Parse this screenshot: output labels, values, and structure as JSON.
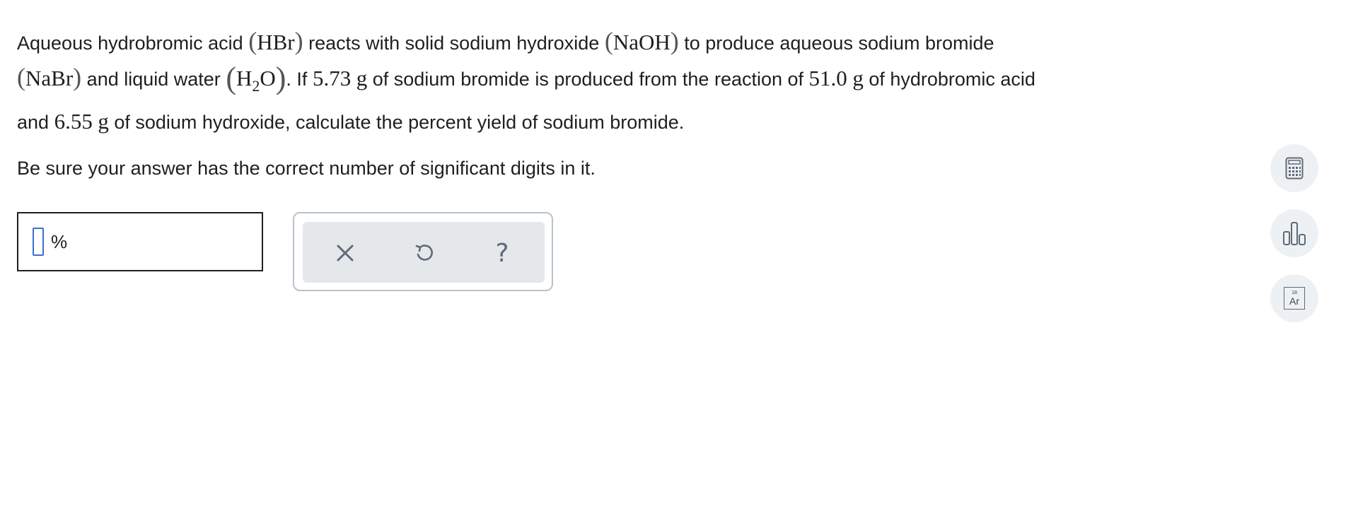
{
  "question": {
    "t1": "Aqueous hydrobromic acid",
    "hbr_formula": "HBr",
    "t2": "reacts with solid sodium hydroxide",
    "naoh_formula": "NaOH",
    "t3": "to produce aqueous sodium bromide",
    "nabr_formula": "NaBr",
    "t4": "and liquid water",
    "water_h": "H",
    "water_sub": "2",
    "water_o": "O",
    "t5": ". If",
    "nabr_mass": "5.73",
    "unit_g1": "g",
    "t6": "of sodium bromide is produced from the reaction of",
    "hbr_mass": "51.0",
    "unit_g2": "g",
    "t7": "of hydrobromic acid",
    "t8": "and",
    "naoh_mass": "6.55",
    "unit_g3": "g",
    "t9": "of sodium hydroxide, calculate the percent yield of sodium bromide."
  },
  "instruction": "Be sure your answer has the correct number of significant digits in it.",
  "answer": {
    "value": "",
    "unit": "%"
  },
  "toolbar": {
    "clear_icon": "x-icon",
    "undo_icon": "undo-icon",
    "help_icon": "question-mark-icon",
    "help_label": "?"
  },
  "sidebar": {
    "calculator_icon": "calculator-icon",
    "chart_icon": "bar-chart-icon",
    "periodic_table_icon": "periodic-table-icon",
    "element_number": "18",
    "element_symbol": "Ar"
  },
  "colors": {
    "accent": "#3a6fd8",
    "icon": "#5e6b78",
    "panel_bg": "#e4e8eb",
    "side_btn_bg": "#eef1f4"
  }
}
